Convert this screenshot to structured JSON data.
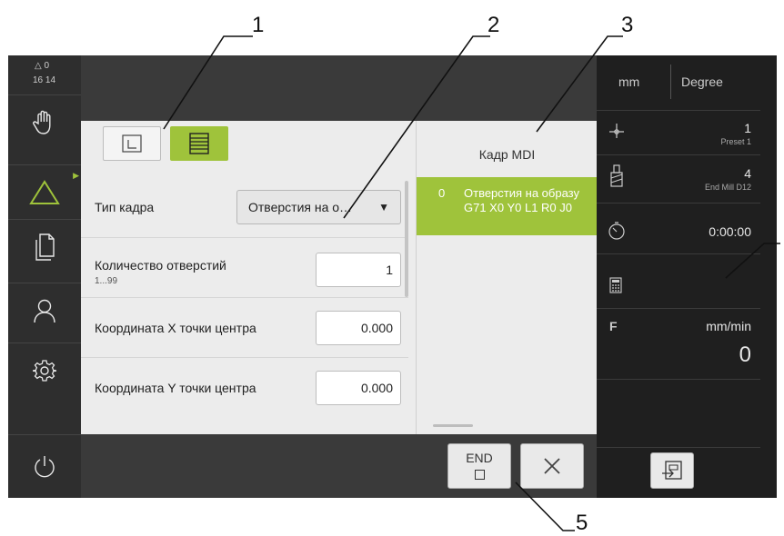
{
  "callouts": [
    "1",
    "2",
    "3",
    "4",
    "5"
  ],
  "status": {
    "warning_count": "0",
    "time": "16 14"
  },
  "sidebar": {
    "items": [
      {
        "icon": "hand-icon"
      },
      {
        "icon": "triangle-icon"
      },
      {
        "icon": "documents-icon"
      },
      {
        "icon": "user-icon"
      },
      {
        "icon": "gear-icon"
      },
      {
        "icon": "power-icon"
      }
    ]
  },
  "form": {
    "block_type_label": "Тип кадра",
    "block_type_value": "Отверстия на о…",
    "hole_count_label": "Количество отверстий",
    "hole_count_hint": "1...99",
    "hole_count_value": "1",
    "center_x_label": "Координата X точки центра",
    "center_x_value": "0.000",
    "center_y_label": "Координата Y точки центра",
    "center_y_value": "0.000"
  },
  "mdi": {
    "title": "Кадр MDI",
    "row_index": "0",
    "row_line1": "Отверстия на образу",
    "row_line2": "G71 X0 Y0 L1 R0 J0"
  },
  "bottom": {
    "end_label": "END"
  },
  "right": {
    "unit_linear": "mm",
    "unit_angular": "Degree",
    "preset_value": "1",
    "preset_label": "Preset 1",
    "tool_value": "4",
    "tool_label": "End Mill D12",
    "timer_value": "0:00:00",
    "feed_letter": "F",
    "feed_unit": "mm/min",
    "feed_value": "0"
  },
  "colors": {
    "accent": "#9fc33b",
    "dark": "#3a3a3a",
    "panel": "#ececec"
  }
}
